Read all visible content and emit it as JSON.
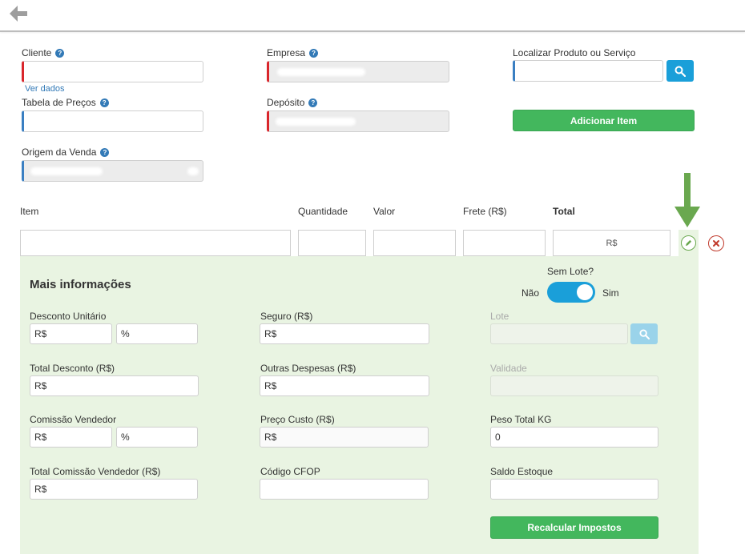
{
  "header": {
    "back_icon": "arrow-left-icon"
  },
  "form": {
    "cliente_label": "Cliente",
    "empresa_label": "Empresa",
    "localizar_label": "Localizar Produto ou Serviço",
    "ver_dados": "Ver dados",
    "tabela_label": "Tabela de Preços",
    "deposito_label": "Depósito",
    "adicionar_button": "Adicionar Item",
    "origem_label": "Origem da Venda"
  },
  "item_table": {
    "headers": {
      "item": "Item",
      "quantidade": "Quantidade",
      "valor": "Valor",
      "frete": "Frete (R$)",
      "total": "Total"
    },
    "total_value": "R$"
  },
  "details": {
    "title": "Mais informações",
    "sem_lote": {
      "label": "Sem Lote?",
      "off": "Não",
      "on": "Sim",
      "checked": true
    },
    "desconto_unitario": {
      "label": "Desconto Unitário",
      "currency": "R$",
      "percent": "%"
    },
    "total_desconto": {
      "label": "Total Desconto (R$)",
      "value": "R$"
    },
    "comissao_vendedor": {
      "label": "Comissão Vendedor",
      "currency": "R$",
      "percent": "%"
    },
    "total_comissao": {
      "label": "Total Comissão Vendedor (R$)",
      "value": "R$"
    },
    "seguro": {
      "label": "Seguro (R$)",
      "value": "R$"
    },
    "outras_despesas": {
      "label": "Outras Despesas (R$)",
      "value": "R$"
    },
    "preco_custo": {
      "label": "Preço Custo (R$)",
      "value": "R$"
    },
    "codigo_cfop": {
      "label": "Código CFOP",
      "value": ""
    },
    "lote": {
      "label": "Lote"
    },
    "validade": {
      "label": "Validade"
    },
    "peso_total": {
      "label": "Peso Total KG",
      "value": "0"
    },
    "saldo_estoque": {
      "label": "Saldo Estoque",
      "value": ""
    },
    "recalcular_button": "Recalcular Impostos"
  },
  "colors": {
    "accent_blue": "#1a9fd9",
    "green_button": "#43b75d",
    "required_red": "#d9262c",
    "panel_bg": "#e9f4e2",
    "arrow_green": "#6aa84f",
    "delete_red": "#c0392b"
  }
}
